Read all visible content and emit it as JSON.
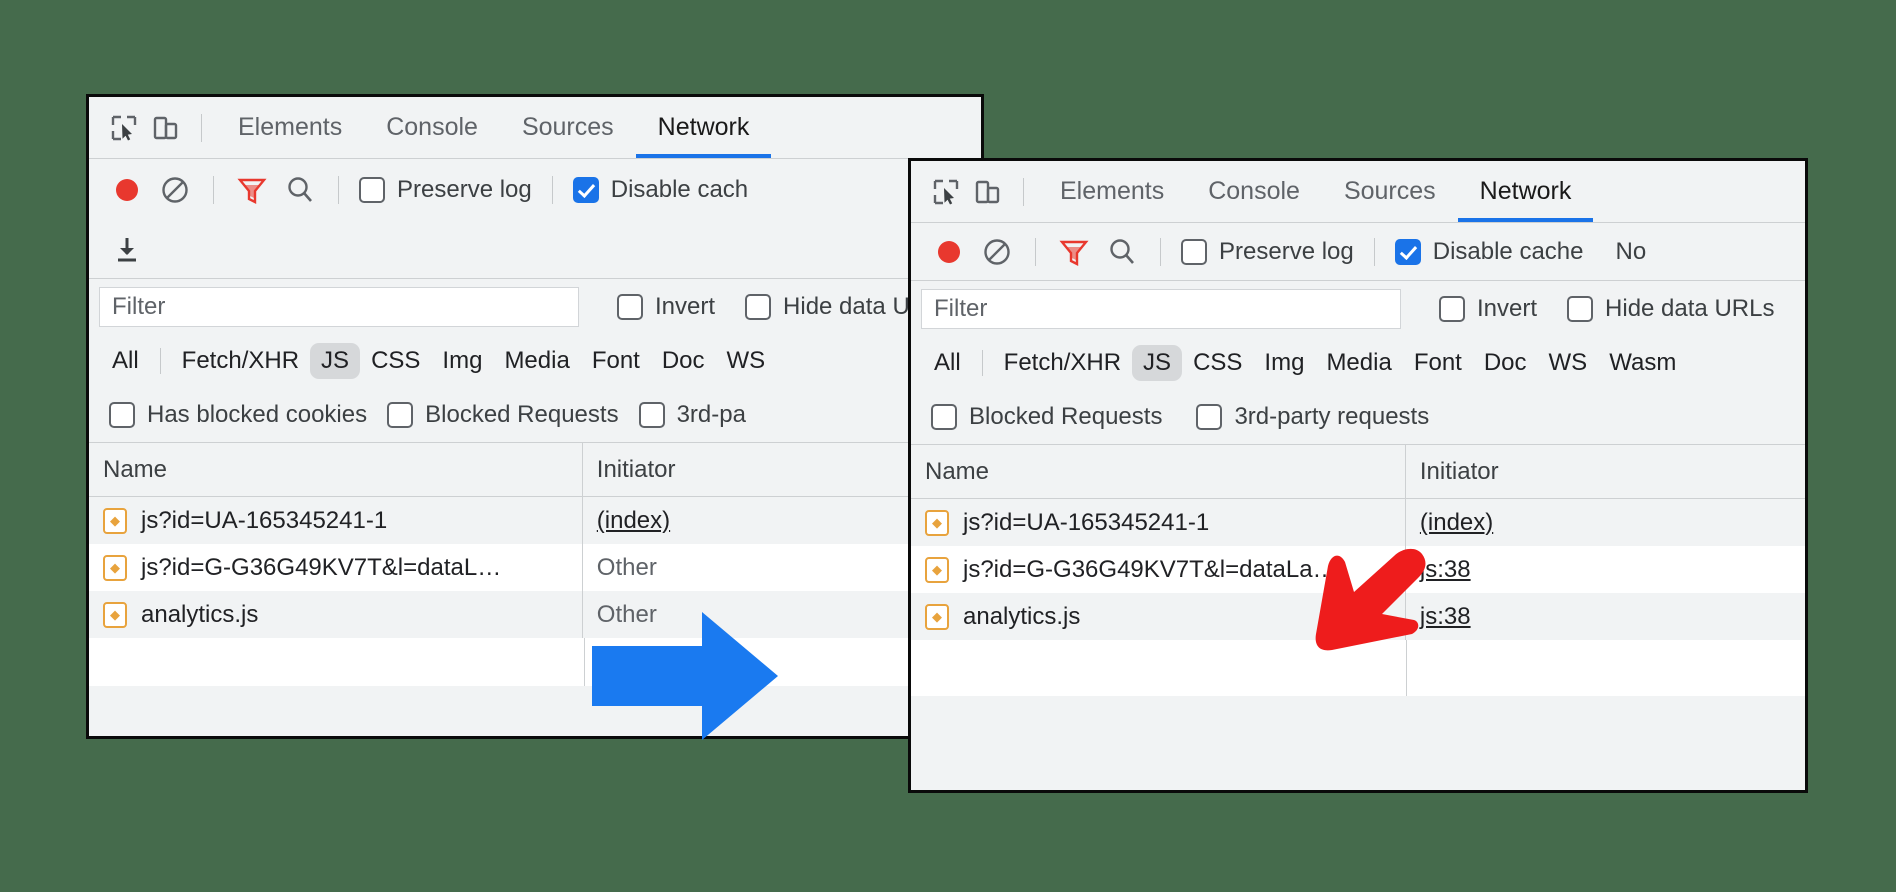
{
  "meta": {
    "background_color": "#456b4c",
    "accent_blue": "#1a73e8",
    "arrow_blue": "#1a73e8",
    "arrow_red": "#ee1c1c",
    "js_icon_color": "#e8a33d"
  },
  "panels": {
    "left": {
      "tabs": [
        {
          "label": "Elements",
          "active": false
        },
        {
          "label": "Console",
          "active": false
        },
        {
          "label": "Sources",
          "active": false
        },
        {
          "label": "Network",
          "active": true
        }
      ],
      "toolbar": {
        "record_icon": "record-circle-icon",
        "clear_icon": "clear-no-entry-icon",
        "filter_icon": "funnel-filter-icon",
        "search_icon": "search-magnifier-icon",
        "export_icon": "download-har-icon",
        "preserve_log": {
          "label": "Preserve log",
          "checked": false
        },
        "disable_cache": {
          "label": "Disable cach",
          "checked": true
        }
      },
      "filter": {
        "placeholder": "Filter",
        "value": "",
        "invert": {
          "label": "Invert",
          "checked": false
        },
        "hide_data_urls": {
          "label": "Hide data UR",
          "checked": false
        }
      },
      "type_filters": [
        {
          "label": "All",
          "selected": false
        },
        {
          "label": "Fetch/XHR",
          "selected": false
        },
        {
          "label": "JS",
          "selected": true
        },
        {
          "label": "CSS",
          "selected": false
        },
        {
          "label": "Img",
          "selected": false
        },
        {
          "label": "Media",
          "selected": false
        },
        {
          "label": "Font",
          "selected": false
        },
        {
          "label": "Doc",
          "selected": false
        },
        {
          "label": "WS",
          "selected": false
        }
      ],
      "extra_filters": [
        {
          "label": "Has blocked cookies",
          "checked": false
        },
        {
          "label": "Blocked Requests",
          "checked": false
        },
        {
          "label": "3rd-pa",
          "checked": false
        }
      ],
      "table": {
        "columns": [
          "Name",
          "Initiator"
        ],
        "rows": [
          {
            "name": "js?id=UA-165345241-1",
            "initiator": "(index)",
            "initiator_link": true
          },
          {
            "name": "js?id=G-G36G49KV7T&l=dataL…",
            "initiator": "Other",
            "initiator_link": false
          },
          {
            "name": "analytics.js",
            "initiator": "Other",
            "initiator_link": false
          }
        ]
      }
    },
    "right": {
      "tabs": [
        {
          "label": "Elements",
          "active": false
        },
        {
          "label": "Console",
          "active": false
        },
        {
          "label": "Sources",
          "active": false
        },
        {
          "label": "Network",
          "active": true
        }
      ],
      "toolbar": {
        "record_icon": "record-circle-icon",
        "clear_icon": "clear-no-entry-icon",
        "filter_icon": "funnel-filter-icon",
        "search_icon": "search-magnifier-icon",
        "preserve_log": {
          "label": "Preserve log",
          "checked": false
        },
        "disable_cache": {
          "label": "Disable cache",
          "checked": true
        },
        "throttling": "No"
      },
      "filter": {
        "placeholder": "Filter",
        "value": "",
        "invert": {
          "label": "Invert",
          "checked": false
        },
        "hide_data_urls": {
          "label": "Hide data URLs",
          "checked": false
        }
      },
      "type_filters": [
        {
          "label": "All",
          "selected": false
        },
        {
          "label": "Fetch/XHR",
          "selected": false
        },
        {
          "label": "JS",
          "selected": true
        },
        {
          "label": "CSS",
          "selected": false
        },
        {
          "label": "Img",
          "selected": false
        },
        {
          "label": "Media",
          "selected": false
        },
        {
          "label": "Font",
          "selected": false
        },
        {
          "label": "Doc",
          "selected": false
        },
        {
          "label": "WS",
          "selected": false
        },
        {
          "label": "Wasm",
          "selected": false
        }
      ],
      "extra_filters": [
        {
          "label": "Blocked Requests",
          "checked": false
        },
        {
          "label": "3rd-party requests",
          "checked": false
        }
      ],
      "table": {
        "columns": [
          "Name",
          "Initiator"
        ],
        "rows": [
          {
            "name": "js?id=UA-165345241-1",
            "initiator": "(index)",
            "initiator_link": true
          },
          {
            "name": "js?id=G-G36G49KV7T&l=dataLa…",
            "initiator": "js:38",
            "initiator_link": true
          },
          {
            "name": "analytics.js",
            "initiator": "js:38",
            "initiator_link": true
          }
        ]
      }
    }
  },
  "annotations": {
    "blue_arrow": {
      "name": "blue-transition-arrow",
      "direction": "right"
    },
    "red_arrow": {
      "name": "red-callout-arrow",
      "direction": "down-left"
    }
  }
}
